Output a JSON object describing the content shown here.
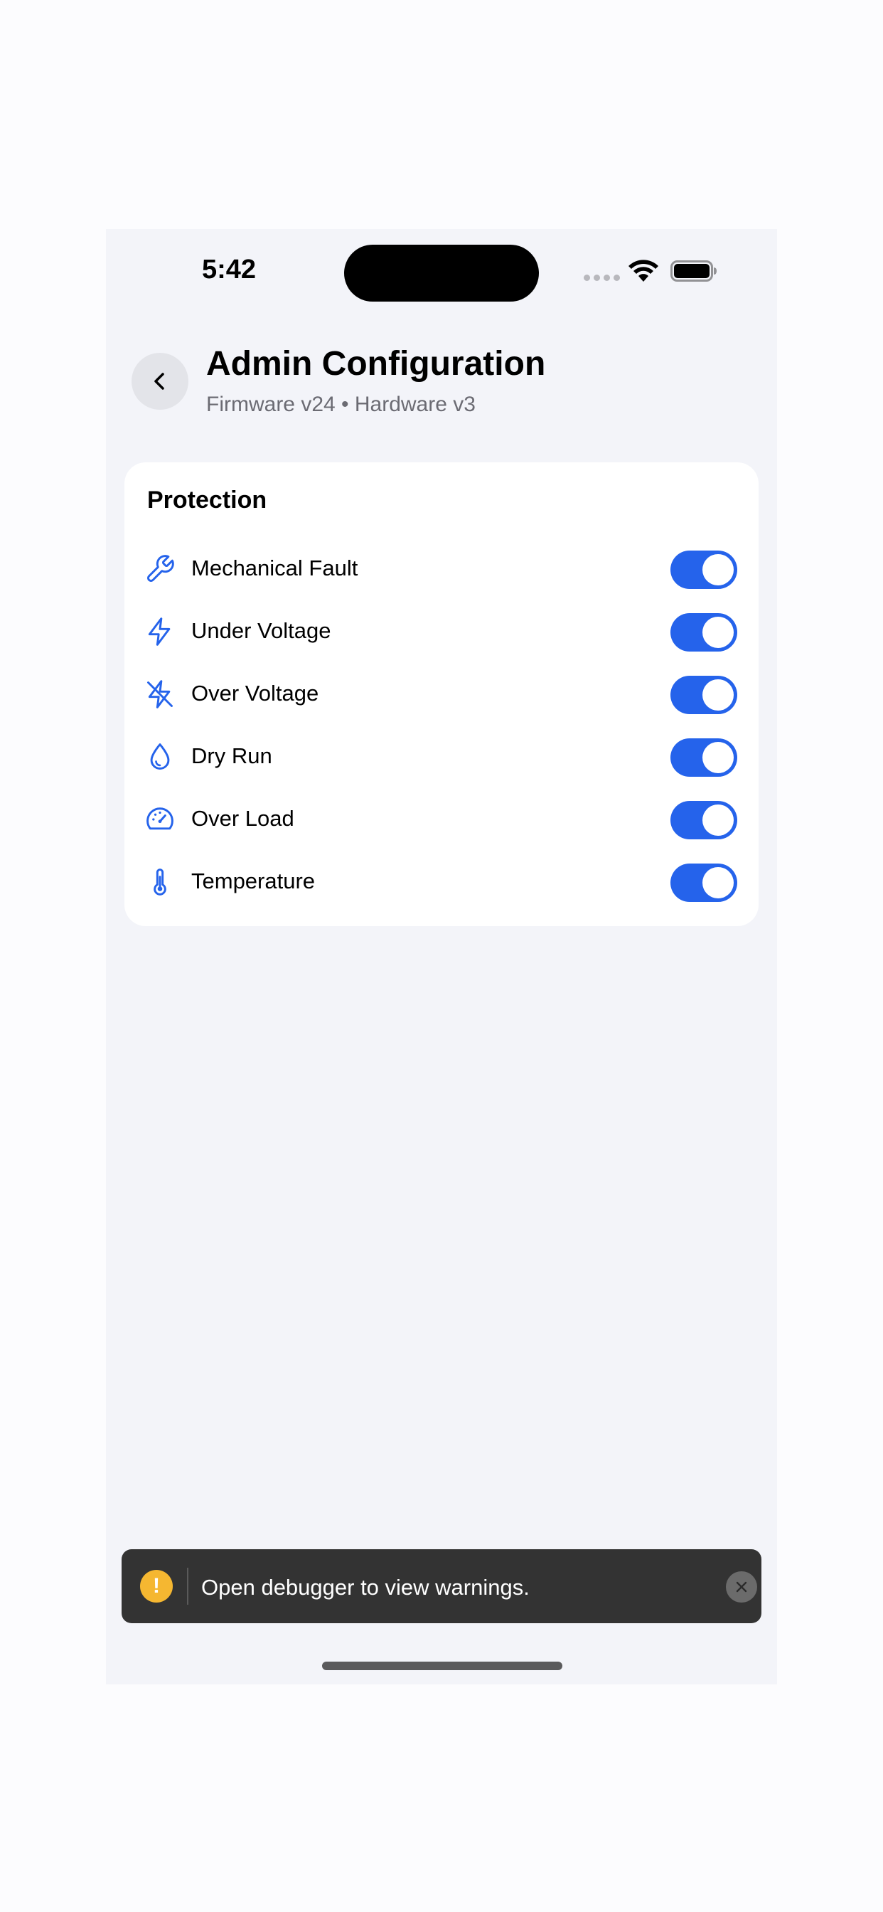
{
  "status_bar": {
    "time": "5:42"
  },
  "header": {
    "back_icon": "chevron-left-icon",
    "title": "Admin Configuration",
    "subtitle": "Firmware v24 • Hardware v3"
  },
  "protection": {
    "title": "Protection",
    "accent_color": "#2563eb",
    "items": [
      {
        "label": "Mechanical Fault",
        "icon": "wrench-icon",
        "enabled": true
      },
      {
        "label": "Under Voltage",
        "icon": "lightning-icon",
        "enabled": true
      },
      {
        "label": "Over Voltage",
        "icon": "lightning-off-icon",
        "enabled": true
      },
      {
        "label": "Dry Run",
        "icon": "water-drop-icon",
        "enabled": true
      },
      {
        "label": "Over Load",
        "icon": "gauge-icon",
        "enabled": true
      },
      {
        "label": "Temperature",
        "icon": "thermometer-icon",
        "enabled": true
      }
    ]
  },
  "toast": {
    "icon": "warning-icon",
    "warn_glyph": "!",
    "message": "Open debugger to view warnings.",
    "close_icon": "close-icon",
    "warn_color": "#f5b731"
  }
}
